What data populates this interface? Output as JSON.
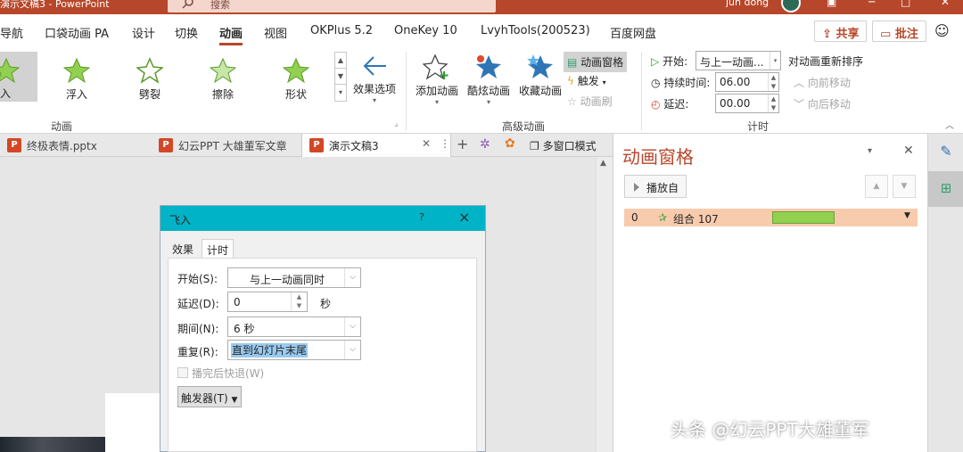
{
  "window": {
    "title": "演示文稿3 - PowerPoint",
    "search_placeholder": "搜索",
    "user": "jun dong"
  },
  "menu_tabs": [
    "导航",
    "口袋动画 PA",
    "设计",
    "切换",
    "动画",
    "视图",
    "OKPlus 5.2",
    "OneKey 10",
    "LvyhTools(200523)",
    "百度网盘"
  ],
  "share": {
    "share_label": "共享",
    "comment_label": "批注"
  },
  "ribbon": {
    "gallery": [
      "入",
      "浮入",
      "劈裂",
      "擦除",
      "形状"
    ],
    "effect_options": "效果选项",
    "group_animation": "动画",
    "add_animation": "添加动画",
    "cool_animation": "酷炫动画",
    "collect_animation": "收藏动画",
    "animation_pane": "动画窗格",
    "trigger": "触发",
    "animation_painter": "动画刷",
    "group_advanced": "高级动画",
    "start_label": "开始:",
    "start_value": "与上一动画...",
    "duration_label": "持续时间:",
    "duration_value": "06.00",
    "delay_label": "延迟:",
    "delay_value": "00.00",
    "reorder_title": "对动画重新排序",
    "move_earlier": "向前移动",
    "move_later": "向后移动",
    "group_timing": "计时"
  },
  "doc_tabs": [
    {
      "label": "终极表情.pptx"
    },
    {
      "label": "幻云PPT 大雄董军文章"
    },
    {
      "label": "演示文稿3"
    }
  ],
  "multi_window": "多窗口模式",
  "dialog": {
    "title": "飞入",
    "help": "?",
    "tabs": [
      "效果",
      "计时"
    ],
    "start_label": "开始(S):",
    "start_value": "与上一动画同时",
    "delay_label": "延迟(D):",
    "delay_value": "0",
    "delay_unit": "秒",
    "period_label": "期间(N):",
    "period_value": "6 秒",
    "repeat_label": "重复(R):",
    "repeat_value": "直到幻灯片末尾",
    "rewind_label": "播完后快退(W)",
    "trigger_label": "触发器(T)"
  },
  "pane": {
    "title": "动画窗格",
    "play_label": "播放自",
    "item_index": "0",
    "item_name": "组合 107"
  },
  "watermark": "头条 @幻云PPT大雄董军",
  "colors": {
    "accent": "#b7472a",
    "dialog_title": "#00b3c6",
    "selected_row": "#f8cbad",
    "timeline_bar": "#92d050"
  }
}
